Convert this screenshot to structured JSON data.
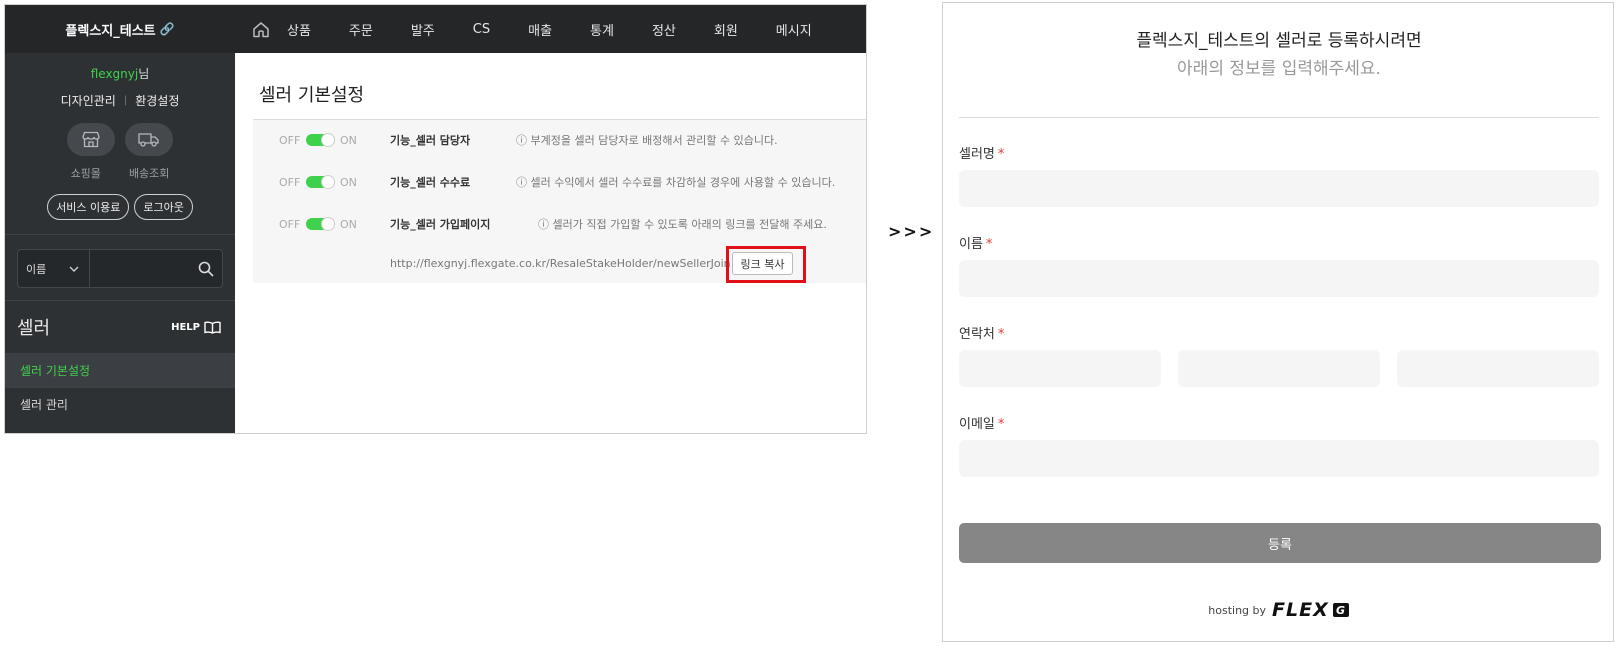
{
  "admin": {
    "brand": "플렉스지_테스트",
    "user": {
      "id": "flexgnyj",
      "suffix": "님"
    },
    "links": [
      "디자인관리",
      "환경설정"
    ],
    "quick": [
      "쇼핑몰",
      "배송조회"
    ],
    "pills": [
      "서비스 이용료",
      "로그아웃"
    ],
    "search": {
      "select": "이름",
      "placeholder": ""
    },
    "section_title": "셀러",
    "help": "HELP",
    "menu": [
      {
        "label": "셀러 기본설정",
        "active": true
      },
      {
        "label": "셀러 관리",
        "active": false
      }
    ],
    "nav": [
      "상품",
      "주문",
      "발주",
      "CS",
      "매출",
      "통계",
      "정산",
      "회원",
      "메시지"
    ],
    "page_title": "셀러 기본설정",
    "rows": [
      {
        "off": "OFF",
        "on": "ON",
        "name": "기능_셀러 담당자",
        "desc": "ⓘ 부계정을 셀러 담당자로 배정해서 관리할 수 있습니다."
      },
      {
        "off": "OFF",
        "on": "ON",
        "name": "기능_셀러 수수료",
        "desc": "ⓘ 셀러 수익에서 셀러 수수료를 차감하실 경우에 사용할 수 있습니다."
      },
      {
        "off": "OFF",
        "on": "ON",
        "name": "기능_셀러 가입페이지",
        "desc": "ⓘ 셀러가 직접 가입할 수 있도록 아래의 링크를 전달해 주세요."
      }
    ],
    "join_url": "http://flexgnyj.flexgate.co.kr/ResaleStakeHolder/newSellerJoin",
    "copy_button": "링크 복사"
  },
  "arrow": ">>>",
  "form": {
    "title": "플렉스지_테스트의 셀러로 등록하시려면",
    "subtitle": "아래의 정보를 입력해주세요.",
    "required_mark": "*",
    "fields": [
      {
        "label": "셀러명"
      },
      {
        "label": "이름"
      },
      {
        "label": "연락처"
      },
      {
        "label": "이메일"
      }
    ],
    "submit": "등록",
    "hosting_by": "hosting by",
    "logo_text": "FLEX",
    "logo_badge": "G"
  },
  "colors": {
    "accent_green": "#3fd14c",
    "sidebar": "#2e3134",
    "topbar": "#242628",
    "highlight": "#e20f17",
    "submit": "#868686"
  }
}
